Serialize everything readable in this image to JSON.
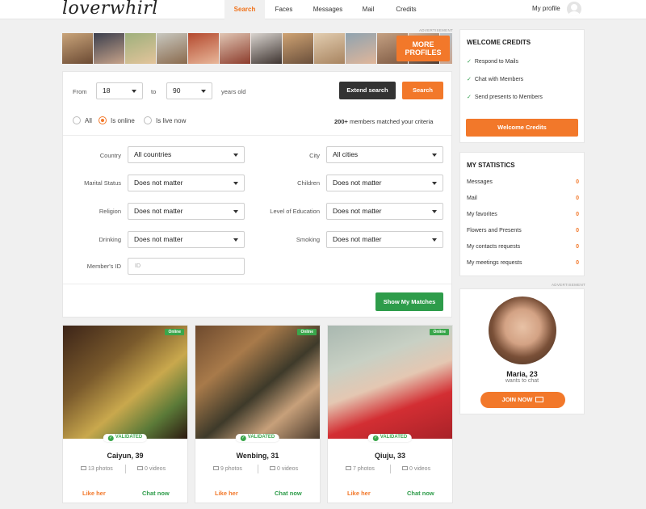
{
  "header": {
    "logo": "loverwhirl",
    "nav": [
      {
        "label": "Search",
        "active": true
      },
      {
        "label": "Faces",
        "active": false
      },
      {
        "label": "Messages",
        "active": false
      },
      {
        "label": "Mail",
        "active": false
      },
      {
        "label": "Credits",
        "active": false
      }
    ],
    "my_profile": "My profile"
  },
  "ad": {
    "label": "ADVERTISEMENT",
    "more_profiles_line1": "MORE",
    "more_profiles_line2": "PROFILES"
  },
  "search": {
    "from_label": "From",
    "from_value": "18",
    "to_label": "to",
    "to_value": "90",
    "years_label": "years old",
    "extend_button": "Extend search",
    "search_button": "Search",
    "radios": [
      {
        "label": "All",
        "selected": false
      },
      {
        "label": "Is online",
        "selected": true
      },
      {
        "label": "Is live now",
        "selected": false
      }
    ],
    "matched_count": "200+",
    "matched_text": "members matched your criteria",
    "filters": {
      "country_label": "Country",
      "country_value": "All countries",
      "city_label": "City",
      "city_value": "All cities",
      "marital_label": "Marital Status",
      "marital_value": "Does not matter",
      "children_label": "Children",
      "children_value": "Does not matter",
      "religion_label": "Religion",
      "religion_value": "Does not matter",
      "education_label": "Level of Education",
      "education_value": "Does not matter",
      "drinking_label": "Drinking",
      "drinking_value": "Does not matter",
      "smoking_label": "Smoking",
      "smoking_value": "Does not matter",
      "member_id_label": "Member's ID",
      "member_id_placeholder": "ID"
    },
    "show_matches_button": "Show My Matches"
  },
  "cards": [
    {
      "online": "Online",
      "validated": "VALIDATED",
      "name": "Caiyun, 39",
      "photos": "13 photos",
      "videos": "0 videos",
      "like": "Like her",
      "chat": "Chat now"
    },
    {
      "online": "Online",
      "validated": "VALIDATED",
      "name": "Wenbing, 31",
      "photos": "9 photos",
      "videos": "0 videos",
      "like": "Like her",
      "chat": "Chat now"
    },
    {
      "online": "Online",
      "validated": "VALIDATED",
      "name": "Qiuju, 33",
      "photos": "7 photos",
      "videos": "0 videos",
      "like": "Like her",
      "chat": "Chat now"
    }
  ],
  "credits": {
    "title": "WELCOME CREDITS",
    "items": [
      "Respond to Mails",
      "Chat with Members",
      "Send presents to Members"
    ],
    "button": "Welcome Credits"
  },
  "stats": {
    "title": "MY STATISTICS",
    "rows": [
      {
        "label": "Messages",
        "value": "0"
      },
      {
        "label": "Mail",
        "value": "0"
      },
      {
        "label": "My favorites",
        "value": "0"
      },
      {
        "label": "Flowers and Presents",
        "value": "0"
      },
      {
        "label": "My contacts requests",
        "value": "0"
      },
      {
        "label": "My meetings requests",
        "value": "0"
      }
    ]
  },
  "promo": {
    "label": "ADVERTISEMENT",
    "name": "Maria, 23",
    "sub": "wants to chat",
    "button": "JOIN NOW"
  },
  "colors": {
    "accent": "#f2782a",
    "green": "#2e9c4a",
    "dark": "#333333"
  }
}
